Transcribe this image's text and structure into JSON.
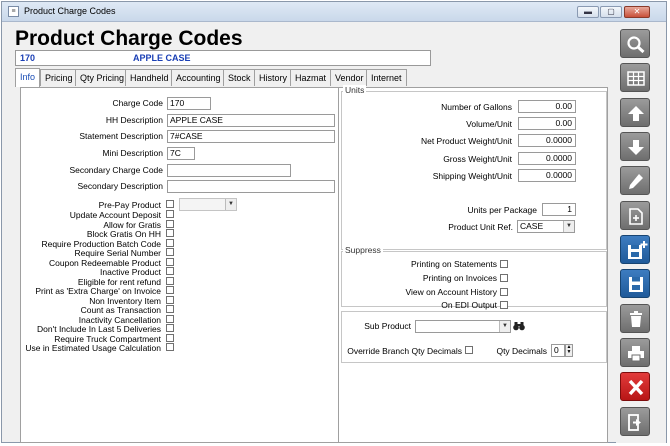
{
  "window": {
    "title": "Product Charge Codes"
  },
  "header": {
    "title": "Product Charge Codes",
    "code": "170",
    "description": "APPLE CASE"
  },
  "tabs": [
    "Info",
    "Pricing",
    "Qty Pricing",
    "Handheld",
    "Accounting",
    "Stock",
    "History",
    "Hazmat",
    "Vendor",
    "Internet"
  ],
  "fields": {
    "charge_code": {
      "label": "Charge Code",
      "value": "170"
    },
    "hh_description": {
      "label": "HH Description",
      "value": "APPLE CASE"
    },
    "statement_description": {
      "label": "Statement Description",
      "value": "7#CASE"
    },
    "mini_description": {
      "label": "Mini Description",
      "value": "7C"
    },
    "secondary_charge_code": {
      "label": "Secondary Charge Code",
      "value": ""
    },
    "secondary_description": {
      "label": "Secondary Description",
      "value": ""
    },
    "pre_pay_product": {
      "label": "Pre-Pay Product",
      "value": ""
    }
  },
  "left_checkboxes": [
    "Update Account Deposit",
    "Allow for Gratis",
    "Block Gratis On HH",
    "Require Production Batch Code",
    "Require Serial Number",
    "Coupon Redeemable Product",
    "Inactive Product",
    "Eligible for rent refund",
    "Print as 'Extra Charge' on Invoice",
    "Non Inventory Item",
    "Count as Transaction",
    "Inactivity Cancellation",
    "Don't Include In Last 5 Deliveries",
    "Require Truck Compartment",
    "Use in Estimated Usage Calculation"
  ],
  "units": {
    "title": "Units",
    "number_of_gallons": {
      "label": "Number of Gallons",
      "value": "0.00"
    },
    "volume_unit": {
      "label": "Volume/Unit",
      "value": "0.00"
    },
    "net_weight": {
      "label": "Net Product Weight/Unit",
      "value": "0.0000"
    },
    "gross_weight": {
      "label": "Gross Weight/Unit",
      "value": "0.0000"
    },
    "shipping_weight": {
      "label": "Shipping Weight/Unit",
      "value": "0.0000"
    },
    "units_per_package": {
      "label": "Units per Package",
      "value": "1"
    },
    "product_unit_ref": {
      "label": "Product Unit Ref.",
      "value": "CASE"
    }
  },
  "suppress": {
    "title": "Suppress",
    "items": [
      "Printing on Statements",
      "Printing on Invoices",
      "View on Account History",
      "On EDI Output"
    ]
  },
  "sub_product": {
    "label": "Sub Product",
    "value": ""
  },
  "override": {
    "label": "Override Branch Qty Decimals",
    "qty_label": "Qty Decimals",
    "qty_value": "0"
  },
  "toolbar": [
    "search-icon",
    "grid-icon",
    "arrow-up-icon",
    "arrow-down-icon",
    "pencil-icon",
    "new-document-icon",
    "save-new-icon",
    "save-icon",
    "trash-icon",
    "print-icon",
    "close-x-icon",
    "exit-door-icon"
  ],
  "colors": {
    "accent": "#1a3fb5",
    "toolbar_gray": "#7d7d7d",
    "toolbar_blue": "#2a69aa",
    "toolbar_red": "#cc2222"
  }
}
